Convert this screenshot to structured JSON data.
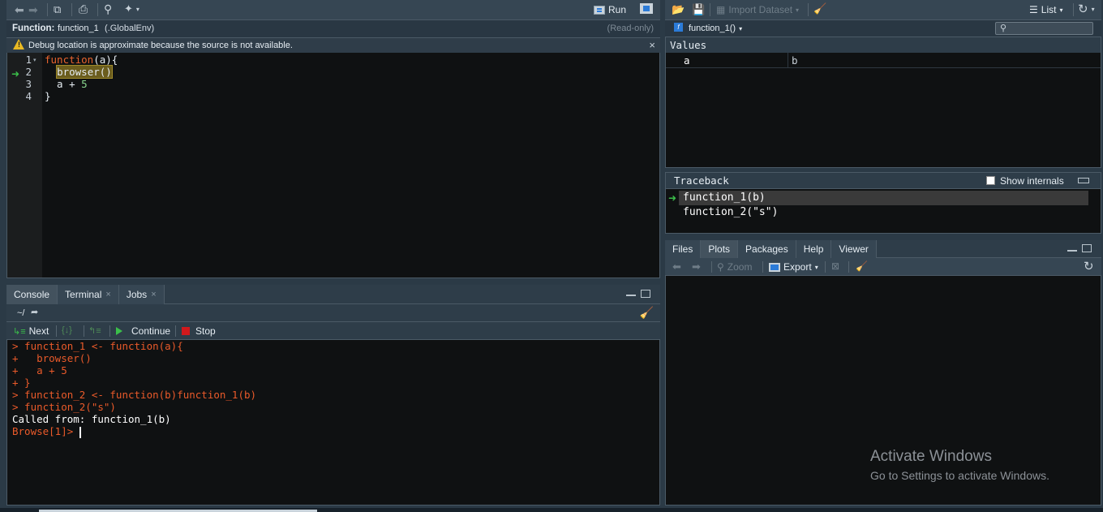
{
  "source_toolbar": {
    "run_label": "Run"
  },
  "function_bar": {
    "function_label": "Function:",
    "function_name": "function_1",
    "env": "(.GlobalEnv)",
    "readonly": "(Read-only)"
  },
  "debug_warning": {
    "text": "Debug location is approximate because the source is not available.",
    "close": "×"
  },
  "editor": {
    "line_numbers": [
      "1",
      "2",
      "3",
      "4"
    ],
    "lines": [
      {
        "parts": [
          {
            "t": "function",
            "c": "#e8632e"
          },
          {
            "t": "(a){",
            "c": "#e6edf3"
          }
        ]
      },
      {
        "parts": [
          {
            "t": "  ",
            "c": "#e6edf3"
          },
          {
            "t": "browser()",
            "c": "#e6edf3",
            "hl": true
          }
        ]
      },
      {
        "parts": [
          {
            "t": "  a + ",
            "c": "#e6edf3"
          },
          {
            "t": "5",
            "c": "#8bd88f"
          }
        ]
      },
      {
        "parts": [
          {
            "t": "}",
            "c": "#e6edf3"
          }
        ]
      }
    ]
  },
  "console_tabs": {
    "console": "Console",
    "terminal": "Terminal",
    "jobs": "Jobs",
    "close_glyph": "×"
  },
  "console_path": "~/",
  "debug_toolbar": {
    "next": "Next",
    "continue": "Continue",
    "stop": "Stop"
  },
  "console": {
    "lines": [
      {
        "text": "> function_1 <- function(a){",
        "c": "#ea5a2a"
      },
      {
        "text": "+   browser()",
        "c": "#ea5a2a"
      },
      {
        "text": "+   a + 5",
        "c": "#ea5a2a"
      },
      {
        "text": "+ }",
        "c": "#ea5a2a"
      },
      {
        "text": "> function_2 <- function(b)function_1(b)",
        "c": "#ea5a2a"
      },
      {
        "text": "> function_2(\"s\")",
        "c": "#ea5a2a"
      },
      {
        "text": "Called from: function_1(b)",
        "c": "#ffffff"
      }
    ],
    "prompt": "Browse[1]> "
  },
  "env_toolbar": {
    "import_dataset": "Import Dataset",
    "list_label": "List"
  },
  "env_context": {
    "function_label": "function_1()"
  },
  "values": {
    "header": "Values",
    "rows": [
      {
        "name": "a",
        "value": "b"
      }
    ]
  },
  "traceback": {
    "header": "Traceback",
    "show_internals": "Show internals",
    "frames": [
      "function_1(b)",
      "function_2(\"s\")"
    ]
  },
  "files_tabs": {
    "files": "Files",
    "plots": "Plots",
    "packages": "Packages",
    "help": "Help",
    "viewer": "Viewer"
  },
  "plots_toolbar": {
    "zoom": "Zoom",
    "export": "Export"
  },
  "watermark": {
    "title": "Activate Windows",
    "subtitle": "Go to Settings to activate Windows."
  }
}
